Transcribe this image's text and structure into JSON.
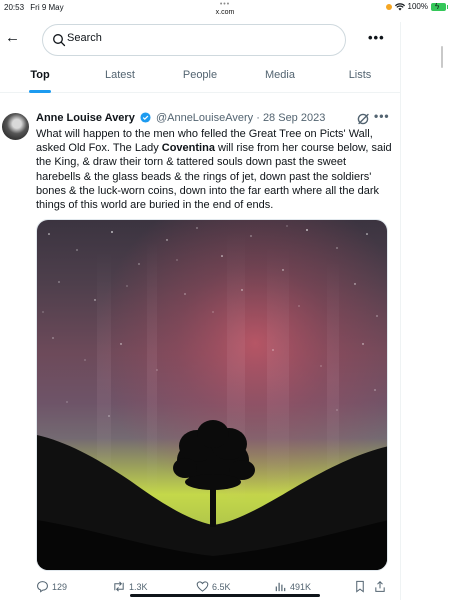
{
  "status_bar": {
    "time": "20:53",
    "date": "Fri 9 May",
    "url": "x.com",
    "battery": "100%"
  },
  "search": {
    "placeholder": "Search"
  },
  "tabs": [
    "Top",
    "Latest",
    "People",
    "Media",
    "Lists"
  ],
  "active_tab": "Top",
  "tweet": {
    "author": "Anne Louise Avery",
    "handle": "@AnneLouiseAvery",
    "date": "· 28 Sep 2023",
    "text_1": "What will happen to the men who felled the Great Tree on Picts' Wall, asked Old Fox. The Lady ",
    "text_bold": "Coventina",
    "text_2": " will rise from her course below, said the King, & draw their torn & tattered souls down past the sweet harebells & the glass beads & the rings of jet, down past the soldiers' bones & the luck-worn coins, down into the far earth where all the dark things of this world are buried in the end of ends.",
    "replies": "129",
    "reposts": "1.3K",
    "likes": "6.5K",
    "views": "491K"
  },
  "colors": {
    "accent": "#1d9bf0",
    "text": "#0f1419",
    "muted": "#536471"
  },
  "icons": [
    "back-arrow-icon",
    "search-icon",
    "more-icon",
    "verified-icon",
    "grok-icon",
    "reply-icon",
    "repost-icon",
    "like-icon",
    "views-icon",
    "bookmark-icon",
    "share-icon"
  ]
}
